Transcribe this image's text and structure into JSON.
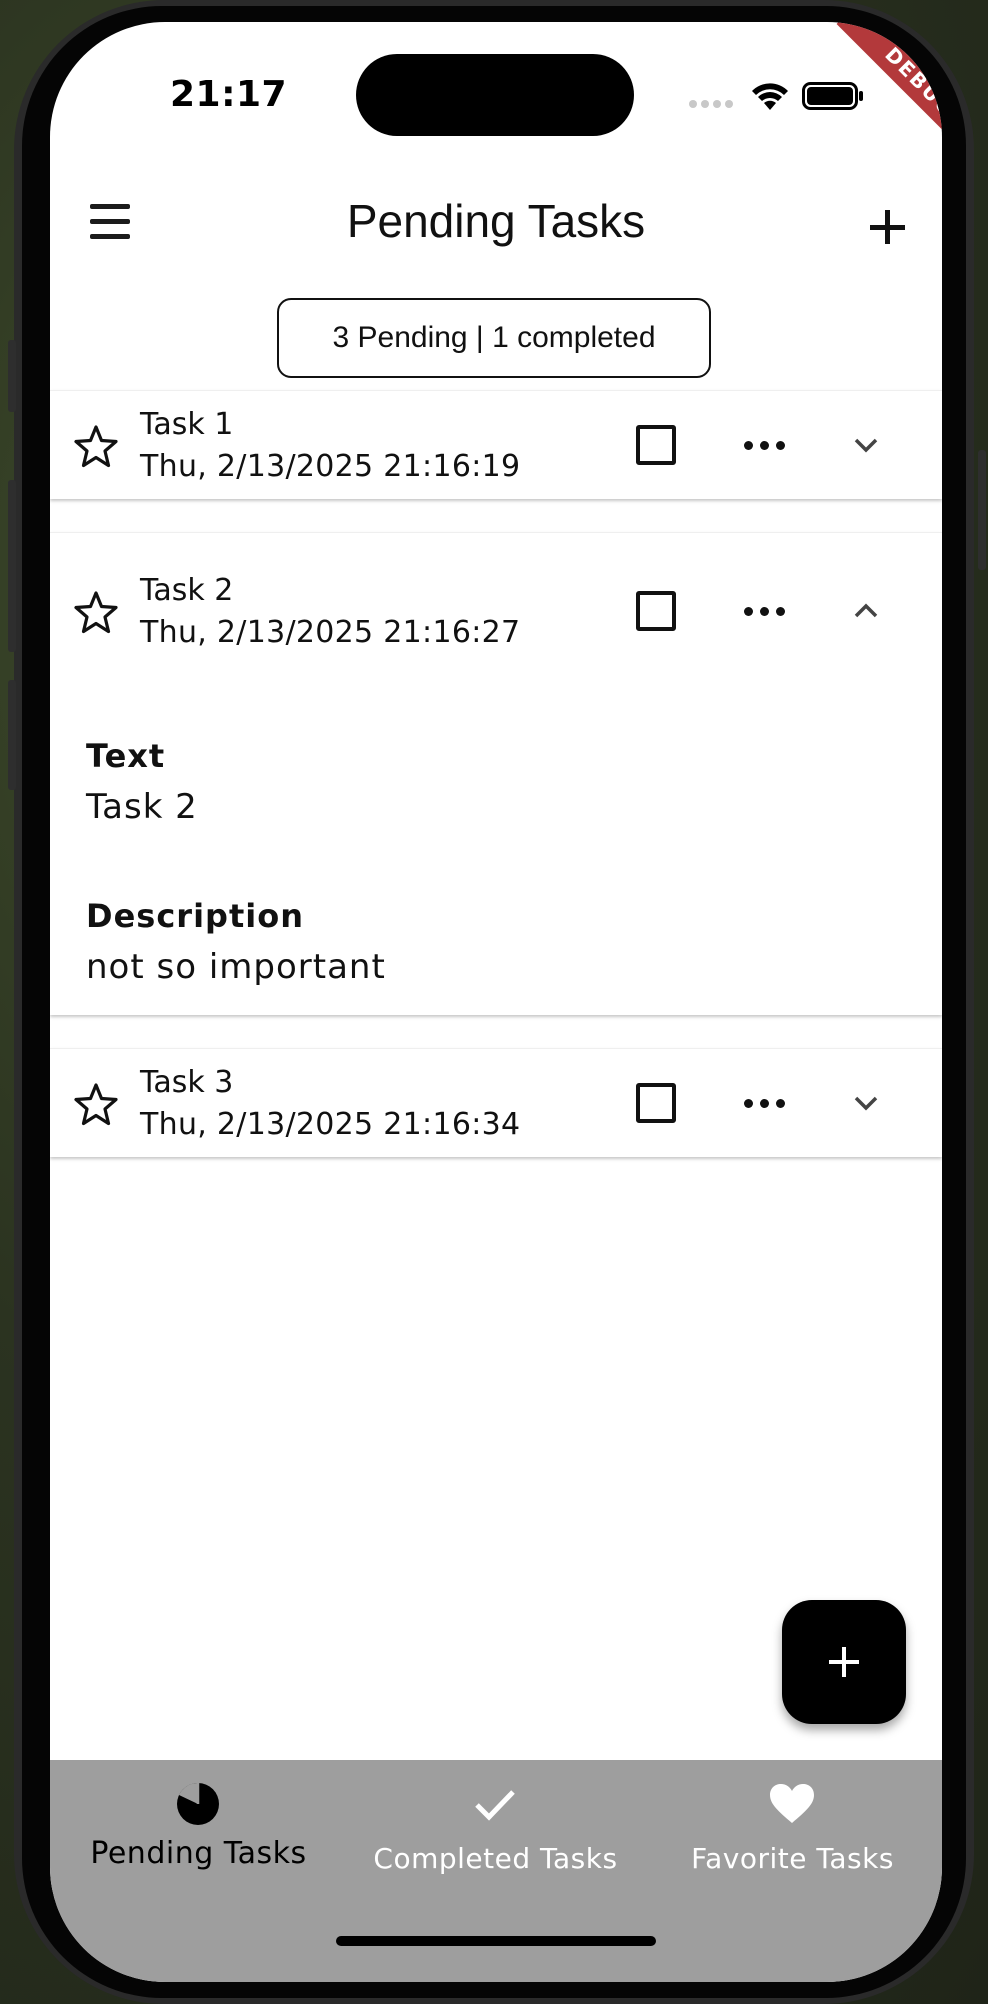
{
  "status_bar": {
    "time": "21:17"
  },
  "debug_banner": "DEBUG",
  "app_bar": {
    "title": "Pending Tasks"
  },
  "summary": "3 Pending | 1 completed",
  "tasks": [
    {
      "name": "Task 1",
      "date": "Thu, 2/13/2025 21:16:19",
      "expanded": false,
      "favorite": false,
      "completed": false
    },
    {
      "name": "Task 2",
      "date": "Thu, 2/13/2025 21:16:27",
      "expanded": true,
      "favorite": false,
      "completed": false,
      "details": {
        "text_label": "Text",
        "text_value": "Task 2",
        "description_label": "Description",
        "description_value": "not so important"
      }
    },
    {
      "name": "Task 3",
      "date": "Thu, 2/13/2025 21:16:34",
      "expanded": false,
      "favorite": false,
      "completed": false
    }
  ],
  "bottom_nav": {
    "items": [
      {
        "label": "Pending Tasks",
        "icon": "pie-chart-icon",
        "selected": true
      },
      {
        "label": "Completed Tasks",
        "icon": "check-icon",
        "selected": false
      },
      {
        "label": "Favorite Tasks",
        "icon": "heart-icon",
        "selected": false
      }
    ]
  },
  "colors": {
    "nav_background": "#9e9e9e",
    "debug_ribbon": "#b3393b",
    "fab": "#000000"
  }
}
